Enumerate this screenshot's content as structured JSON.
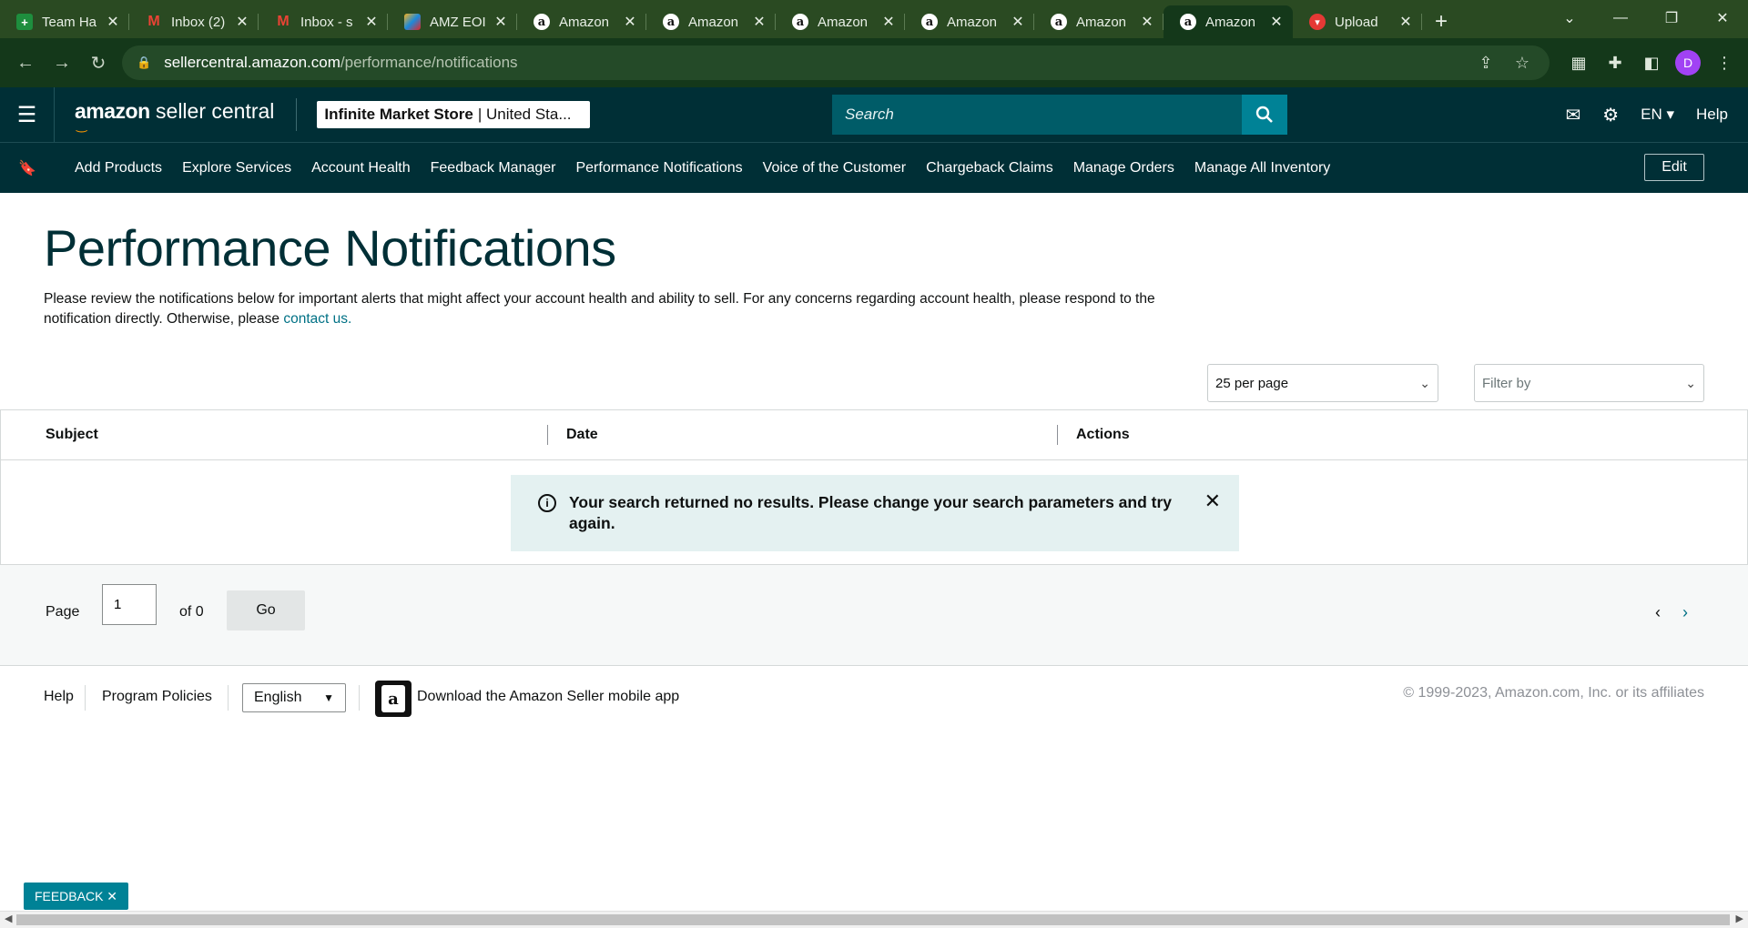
{
  "browser": {
    "tabs": [
      {
        "title": "Team Ha",
        "icon": "sheets-icon",
        "glyph": "+"
      },
      {
        "title": "Inbox (2)",
        "icon": "gmail-icon",
        "glyph": "M"
      },
      {
        "title": "Inbox - s",
        "icon": "gmail-icon",
        "glyph": "M"
      },
      {
        "title": "AMZ EOI",
        "icon": "zoho-icon",
        "glyph": ""
      },
      {
        "title": "Amazon",
        "icon": "amazon-icon",
        "glyph": "a"
      },
      {
        "title": "Amazon",
        "icon": "amazon-icon",
        "glyph": "a"
      },
      {
        "title": "Amazon",
        "icon": "amazon-icon",
        "glyph": "a"
      },
      {
        "title": "Amazon",
        "icon": "amazon-icon",
        "glyph": "a"
      },
      {
        "title": "Amazon",
        "icon": "amazon-icon",
        "glyph": "a"
      },
      {
        "title": "Amazon",
        "icon": "amazon-icon",
        "glyph": "a",
        "active": true
      },
      {
        "title": "Upload",
        "icon": "upload-icon",
        "glyph": "▾"
      }
    ],
    "url_host": "sellercentral.amazon.com",
    "url_path": "/performance/notifications",
    "profile_initial": "D"
  },
  "header": {
    "logo_brand": "amazon",
    "logo_product": "seller central",
    "store_name": "Infinite Market Store",
    "store_region": "| United Sta...",
    "search_placeholder": "Search",
    "language": "EN",
    "help": "Help"
  },
  "nav": {
    "items": [
      "Add Products",
      "Explore Services",
      "Account Health",
      "Feedback Manager",
      "Performance Notifications",
      "Voice of the Customer",
      "Chargeback Claims",
      "Manage Orders",
      "Manage All Inventory"
    ],
    "edit_label": "Edit"
  },
  "main": {
    "title": "Performance Notifications",
    "description": "Please review the notifications below for important alerts that might affect your account health and ability to sell. For any concerns regarding account health, please respond to the notification directly. Otherwise, please ",
    "contact_link": "contact us.",
    "per_page": "25 per page",
    "filter_placeholder": "Filter by",
    "table": {
      "columns": [
        "Subject",
        "Date",
        "Actions"
      ]
    },
    "alert_message": "Your search returned no results. Please change your search parameters and try again."
  },
  "pager": {
    "page_label": "Page",
    "page_value": "1",
    "of_label": "of 0",
    "go_label": "Go"
  },
  "footer": {
    "help": "Help",
    "policies": "Program Policies",
    "language": "English",
    "app_link": "Download the Amazon Seller mobile app",
    "copyright": "© 1999-2023, Amazon.com, Inc. or its affiliates"
  },
  "feedback_label": "FEEDBACK ✕"
}
